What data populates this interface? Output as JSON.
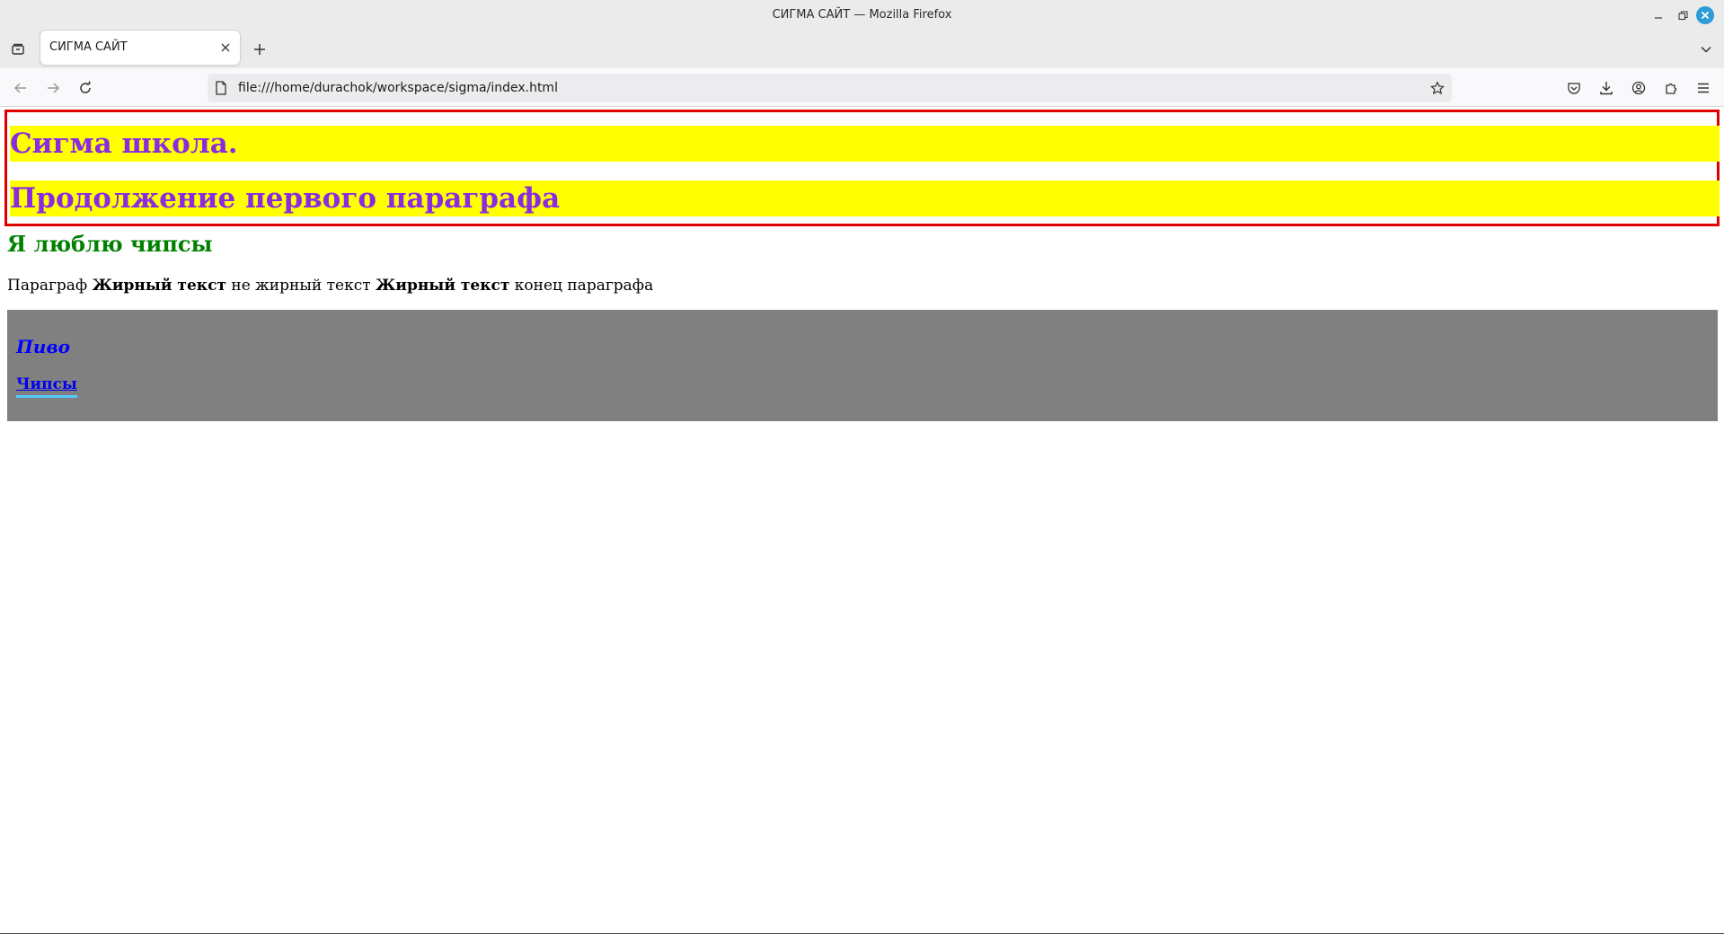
{
  "window": {
    "title": "СИГМА САЙТ — Mozilla Firefox"
  },
  "tabs": [
    {
      "label": "СИГМА САЙТ",
      "active": true
    }
  ],
  "navbar": {
    "url": "file:///home/durachok/workspace/sigma/index.html"
  },
  "page": {
    "heading1": "Сигма школа.",
    "heading2": "Продолжение первого параграфа",
    "heading3": "Я люблю чипсы",
    "paragraph": {
      "text1": "Параграф",
      "bold1": "Жирный текст",
      "text2": "не жирный текст",
      "bold2": "Жирный текст",
      "text3": "конец параграфа"
    },
    "box": {
      "title": "Пиво",
      "link": "Чипсы"
    }
  },
  "colors": {
    "highlight_bg": "#ffff00",
    "heading_purple": "#8a2be2",
    "border_red": "#e00000",
    "heading_green": "#008000",
    "box_gray": "#808080",
    "link_blue": "#0000ee",
    "accent_blue": "#2f9bd6"
  }
}
